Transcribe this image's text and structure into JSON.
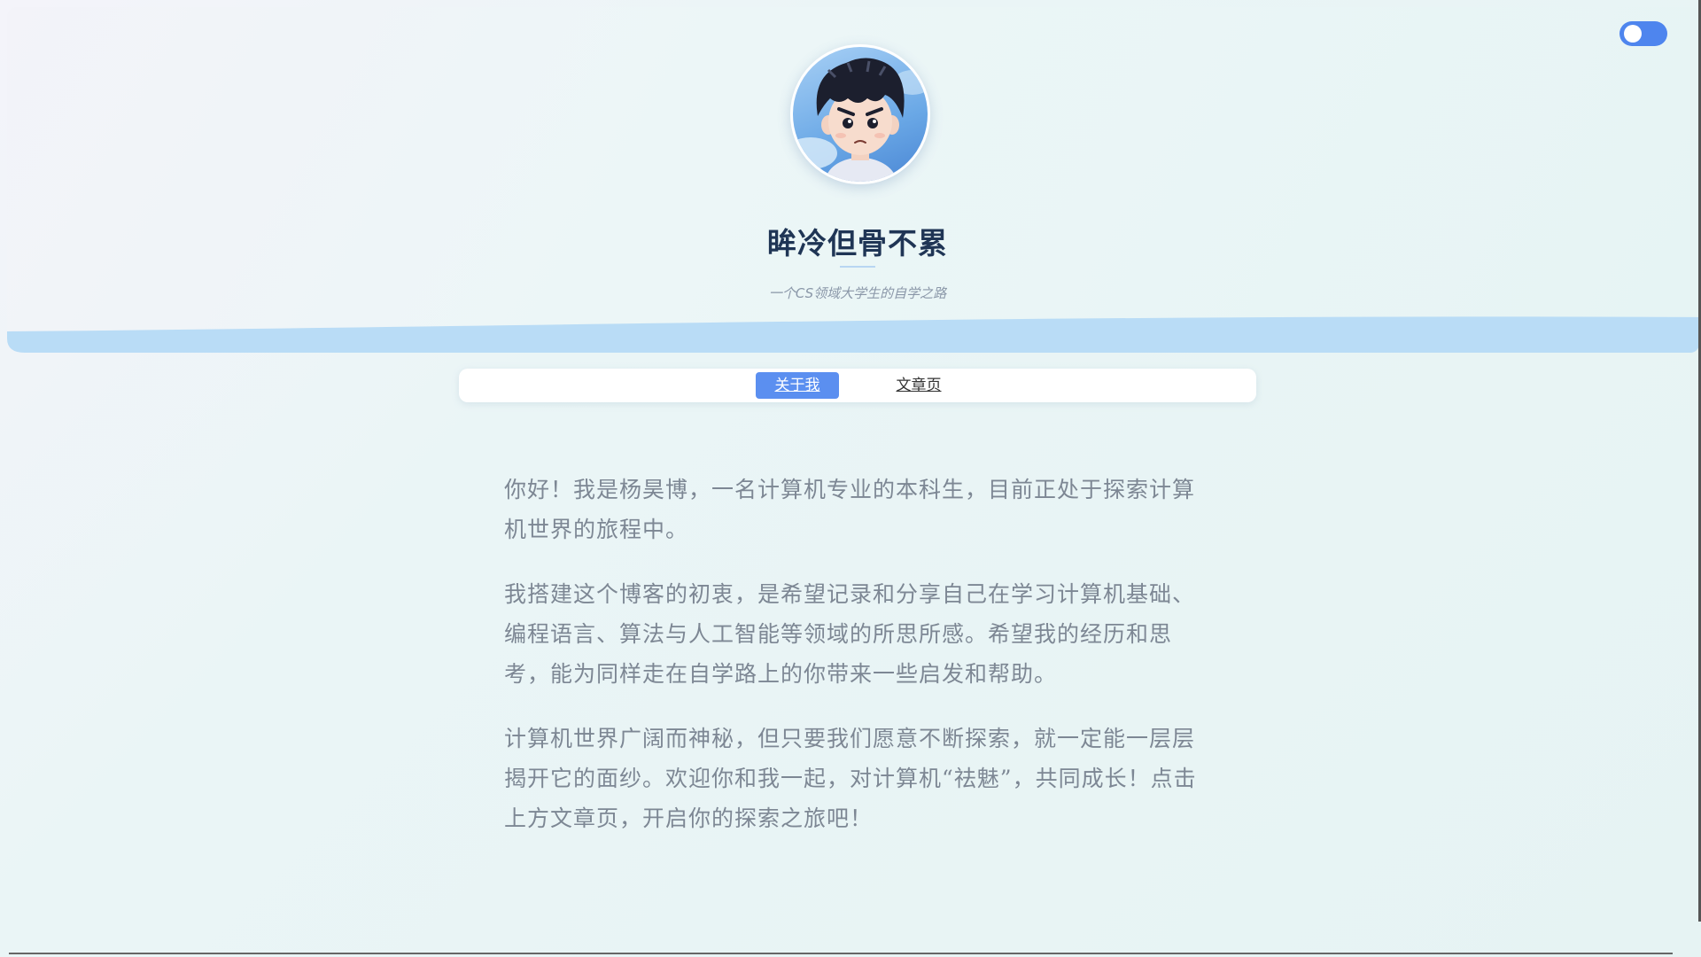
{
  "theme_toggle": {
    "icon": "toggle-switch-icon",
    "color": "#4e85ee"
  },
  "profile": {
    "avatar_icon": "cartoon-boy-avatar",
    "name": "眸冷但骨不累",
    "tagline": "一个CS领域大学生的自学之路"
  },
  "nav": {
    "items": [
      {
        "label": "关于我",
        "active": true
      },
      {
        "label": "文章页",
        "active": false
      }
    ],
    "active_color": "#5b8ff0"
  },
  "about": {
    "paragraphs": [
      "你好！我是杨昊博，一名计算机专业的本科生，目前正处于探索计算机世界的旅程中。",
      "我搭建这个博客的初衷，是希望记录和分享自己在学习计算机基础、编程语言、算法与人工智能等领域的所思所感。希望我的经历和思考，能为同样走在自学路上的你带来一些启发和帮助。",
      "计算机世界广阔而神秘，但只要我们愿意不断探索，就一定能一层层揭开它的面纱。欢迎你和我一起，对计算机“祛魅”，共同成长！点击上方文章页，开启你的探索之旅吧！"
    ]
  }
}
